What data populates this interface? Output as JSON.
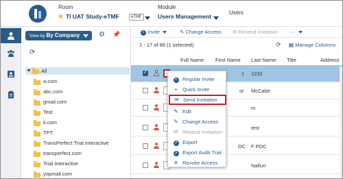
{
  "header": {
    "room_label": "Room",
    "room_value": "TI UAT Study-eTMF",
    "room_badge": "eTMF",
    "module_label": "Module",
    "module_value": "Users Management",
    "page_label": "Users"
  },
  "sidebar": {
    "viewby_prefix": "View by",
    "viewby_value": "By Company",
    "tree": [
      "All",
      "a.com",
      "abc.com",
      "gmail.com",
      "Test",
      "ti.com",
      "TPT",
      "TransPerfect Trial Interactive",
      "transperfect.com",
      "Trial Interactive",
      "yopmail.com"
    ]
  },
  "toolbar": {
    "invite": "Invite",
    "change_access": "Change Access",
    "resend_invitation": "Resend Invitation",
    "more": "···"
  },
  "grid": {
    "count_text": "1 - 17 of 66 (1 selected)",
    "manage_columns": "Manage Columns",
    "columns": [
      "Full Name",
      "First Name",
      "Last Name",
      "Title",
      "Address"
    ],
    "rows": [
      {
        "first": "t",
        "last": "1232",
        "selected": true
      },
      {
        "first": "or",
        "last": "McCabe",
        "selected": false
      },
      {
        "first": "",
        "last": "m",
        "selected": false
      },
      {
        "first": "",
        "last": "test",
        "selected": false
      },
      {
        "first": "DC",
        "last": "F PDC",
        "selected": false
      },
      {
        "first": "",
        "last": "Nalluri",
        "selected": false
      }
    ]
  },
  "menu": {
    "regular_invite": "Regular Invite",
    "quick_invite": "Quick Invite",
    "send_invitation": "Send Invitation",
    "edit": "Edit",
    "change_access": "Change Access",
    "resend_invitation": "Resend Invitation",
    "export": "Export",
    "export_audit_trail": "Export Audit Trail",
    "revoke_access": "Revoke Access"
  },
  "colors": {
    "accent": "#2a5b8a",
    "selected_row": "#9ec4e6",
    "highlight": "#c0202a"
  }
}
